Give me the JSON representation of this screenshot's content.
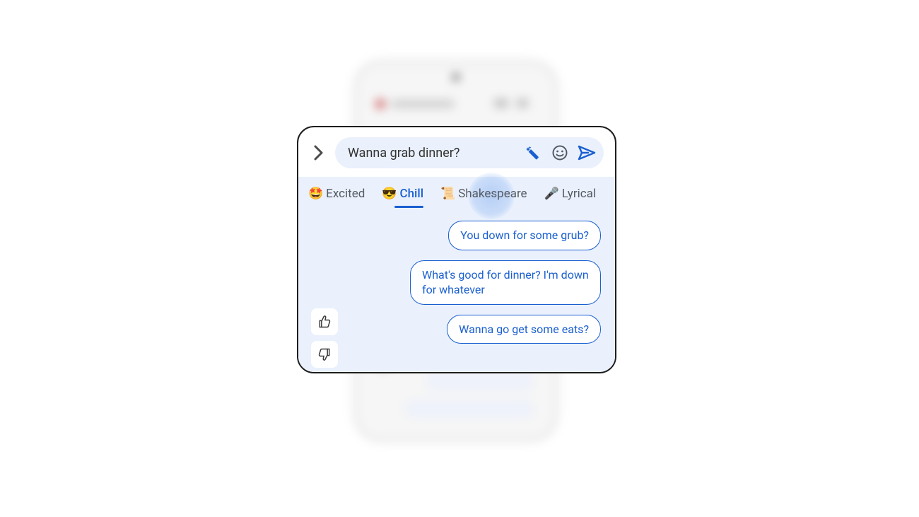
{
  "compose": {
    "text": "Wanna grab dinner?"
  },
  "tabs": [
    {
      "emoji": "🤩",
      "label": "Excited",
      "active": false
    },
    {
      "emoji": "😎",
      "label": "Chill",
      "active": true
    },
    {
      "emoji": "📜",
      "label": "Shakespeare",
      "active": false
    },
    {
      "emoji": "🎤",
      "label": "Lyrical",
      "active": false
    }
  ],
  "suggestions": [
    "You down for some grub?",
    "What's good for dinner? I'm down for whatever",
    "Wanna go get some eats?"
  ],
  "colors": {
    "accent": "#1a5fd0",
    "panel": "#eaf1fd"
  }
}
